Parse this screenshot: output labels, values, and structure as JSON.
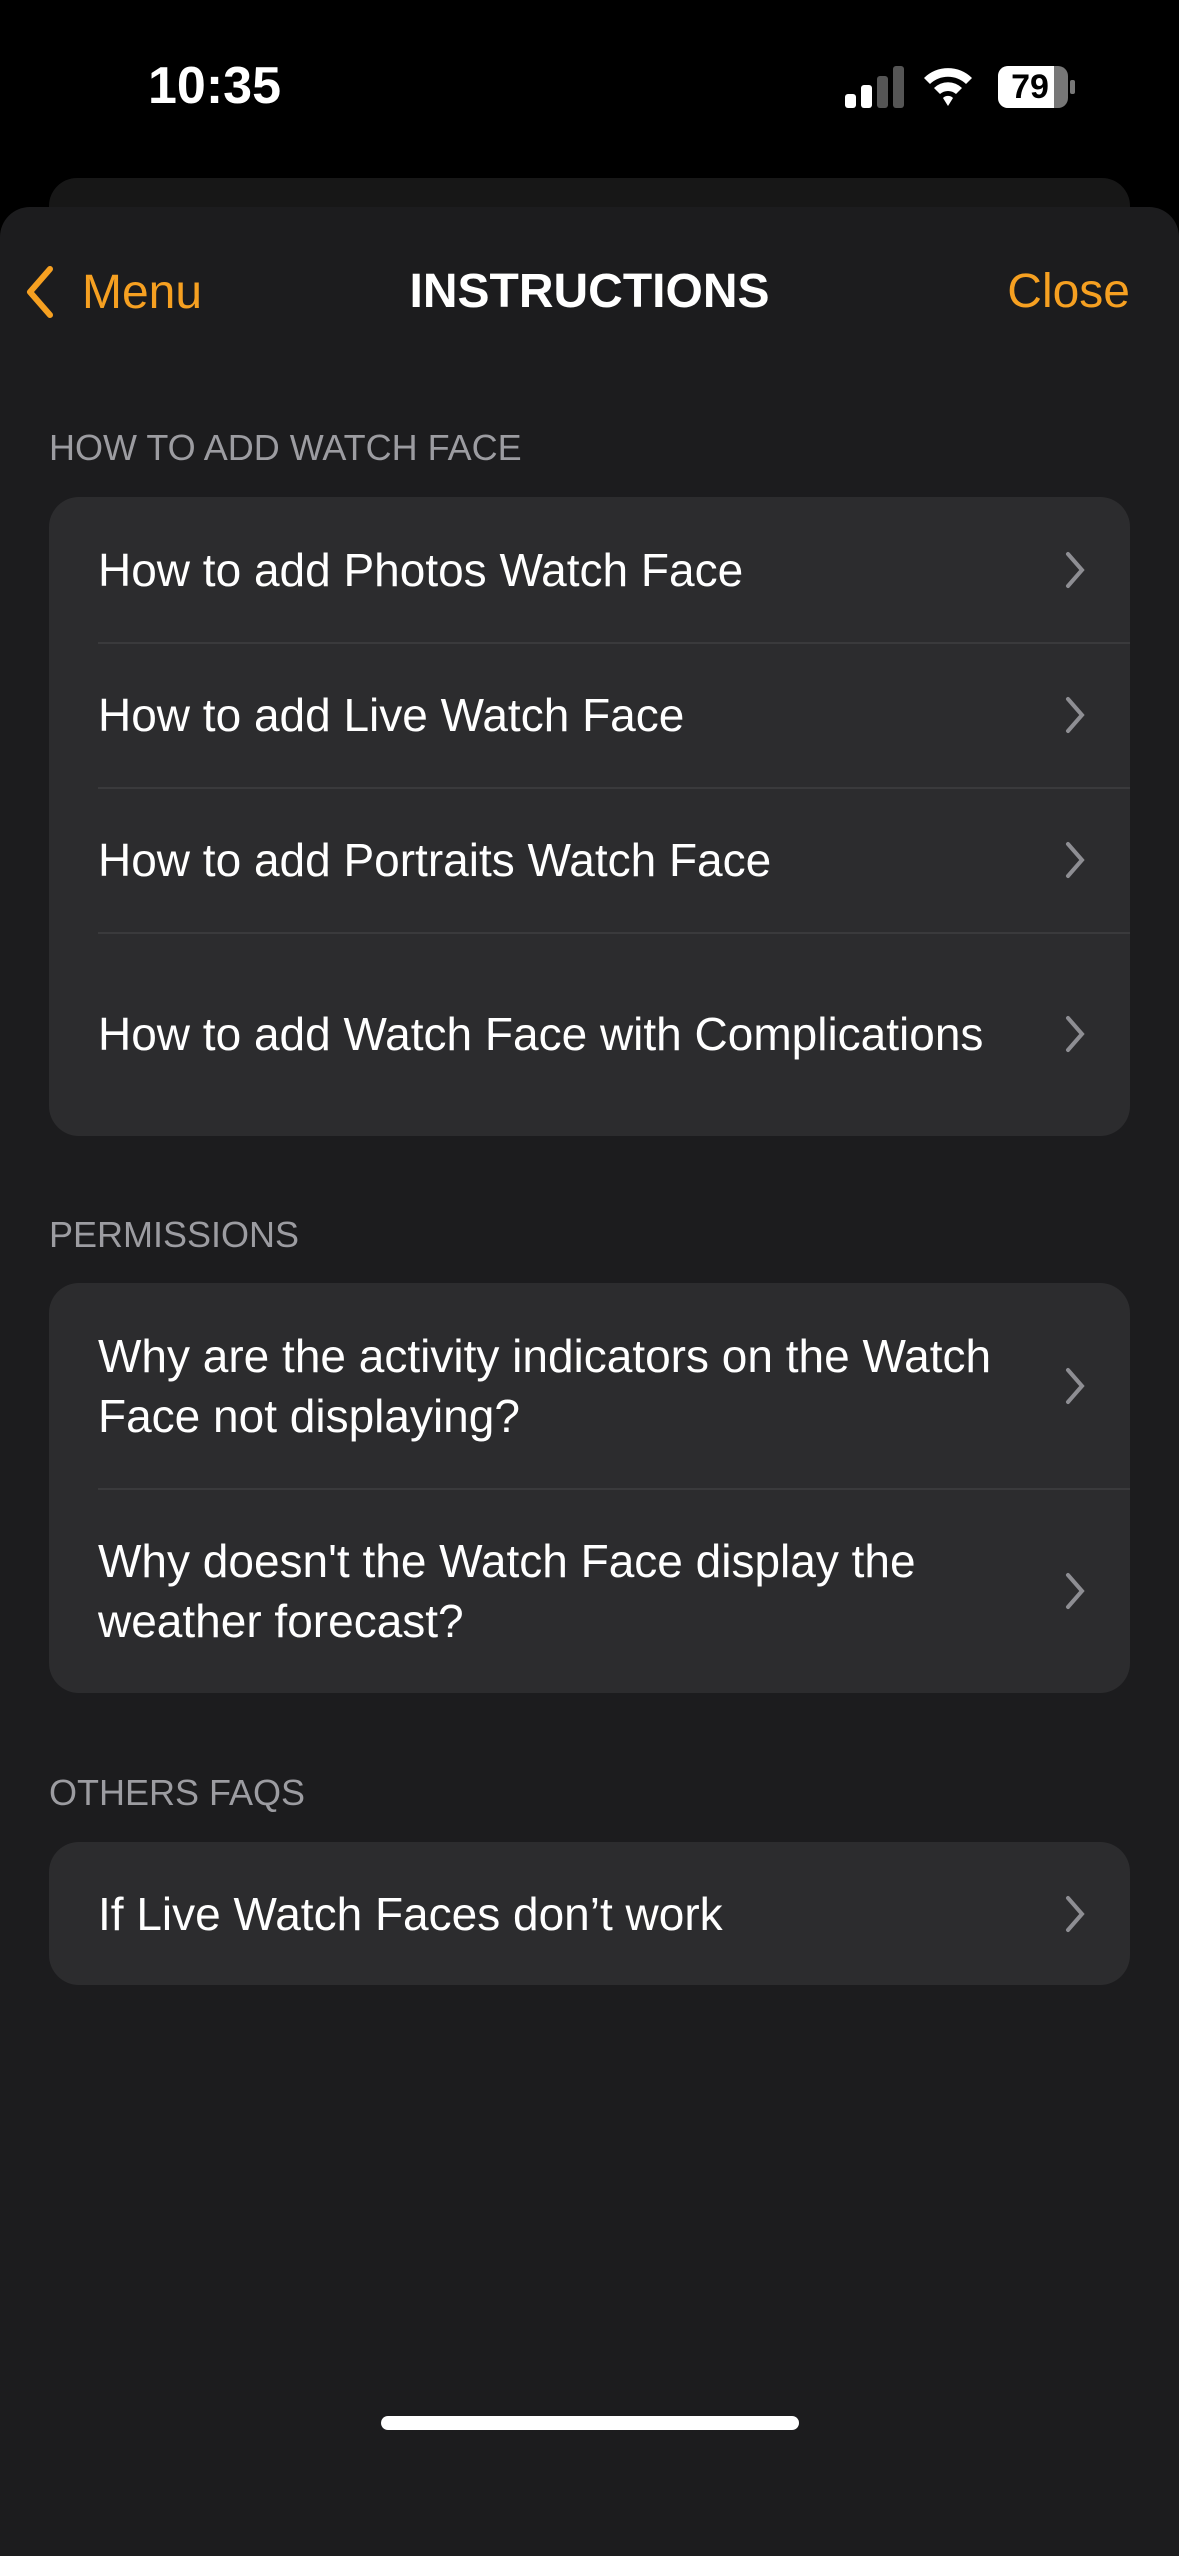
{
  "status_bar": {
    "time": "10:35",
    "battery": "79",
    "battery_level": 79,
    "signal_bars": 2,
    "icons": [
      "cellular-signal-icon",
      "wifi-icon",
      "battery-icon"
    ]
  },
  "nav": {
    "back_label": "Menu",
    "title": "INSTRUCTIONS",
    "close_label": "Close"
  },
  "colors": {
    "accent": "#f6a021",
    "background": "#1c1c1e",
    "cell": "#2c2c2e"
  },
  "sections": [
    {
      "header": "HOW TO ADD WATCH FACE",
      "items": [
        {
          "label": "How to add Photos Watch Face"
        },
        {
          "label": "How to add Live Watch Face"
        },
        {
          "label": "How to add Portraits Watch Face"
        },
        {
          "label": "How to add Watch Face with Complications"
        }
      ]
    },
    {
      "header": "PERMISSIONS",
      "items": [
        {
          "label": "Why are the activity indicators on the Watch Face not displaying?"
        },
        {
          "label": "Why doesn't the Watch Face display the weather forecast?"
        }
      ]
    },
    {
      "header": "OTHERS FAQS",
      "items": [
        {
          "label": "If Live Watch Faces don’t work"
        }
      ]
    }
  ]
}
